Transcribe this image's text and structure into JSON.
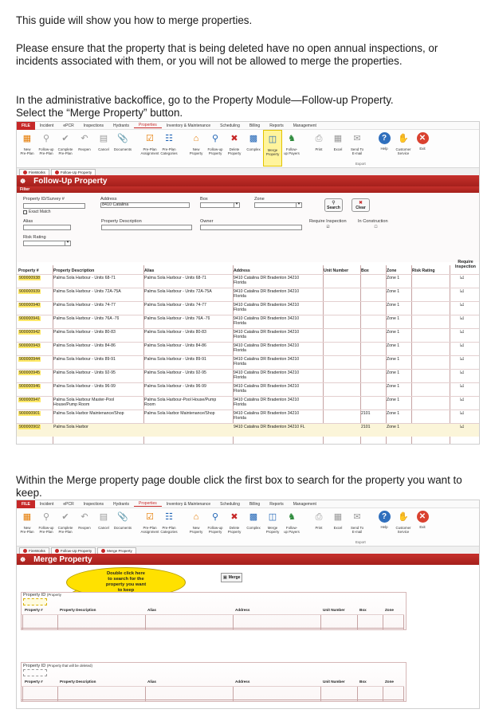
{
  "intro": "This guide will show you how to merge properties.",
  "warning": "Please ensure that the property that is being deleted have no open annual inspections, or incidents associated with them, or you will not be allowed to merge the properties.",
  "step1_line1": "In the administrative backoffice, go to the Property Module—Follow-up Property.",
  "step1_line2": "Select the “Merge Property” button.",
  "step2": "Within the Merge property page double click the first box to search for the property you want to keep.",
  "menu": [
    "FILE",
    "Incident",
    "ePCR",
    "Inspections",
    "Hydrants",
    "Properties",
    "Inventory & Maintenance",
    "Scheduling",
    "Billing",
    "Reports",
    "Management"
  ],
  "ribbon": [
    {
      "l1": "New",
      "l2": "Pre-Plan",
      "icon": "new-preplan-icon"
    },
    {
      "l1": "Follow-up",
      "l2": "Pre-Plan",
      "icon": "follow-up-preplan-icon"
    },
    {
      "l1": "Complete",
      "l2": "Pre-Plan",
      "icon": "complete-icon"
    },
    {
      "l1": "Reopen",
      "l2": "",
      "icon": "reopen-icon"
    },
    {
      "l1": "Cancel",
      "l2": "",
      "icon": "cancel-icon"
    },
    {
      "l1": "Documents",
      "l2": "",
      "icon": "documents-icon"
    },
    {
      "l1": "Pre-Plan",
      "l2": "Assignment",
      "icon": "assignment-icon"
    },
    {
      "l1": "Pre-Plan",
      "l2": "Categories",
      "icon": "categories-icon"
    },
    {
      "l1": "New",
      "l2": "Property",
      "icon": "new-property-icon"
    },
    {
      "l1": "Follow-up",
      "l2": "Property",
      "icon": "follow-up-property-icon"
    },
    {
      "l1": "Delete",
      "l2": "Property",
      "icon": "delete-property-icon"
    },
    {
      "l1": "Complex",
      "l2": "",
      "icon": "complex-icon"
    },
    {
      "l1": "Merge",
      "l2": "Property",
      "icon": "merge-property-icon"
    },
    {
      "l1": "Follow-",
      "l2": "up Payers",
      "icon": "payers-icon"
    },
    {
      "l1": "Print",
      "l2": "",
      "icon": "print-icon"
    },
    {
      "l1": "Excel",
      "l2": "",
      "icon": "excel-icon"
    },
    {
      "l1": "Send To",
      "l2": "E-mail",
      "icon": "email-icon"
    },
    {
      "l1": "Help",
      "l2": "",
      "icon": "help-icon"
    },
    {
      "l1": "Customer",
      "l2": "Service",
      "icon": "customer-service-icon"
    },
    {
      "l1": "Exit",
      "l2": "",
      "icon": "exit-icon"
    }
  ],
  "export_group": "Export",
  "shot1": {
    "tabs": [
      "FireWorks",
      "Follow-Up Property"
    ],
    "title": "Follow-Up Property",
    "filter_label": "Filter",
    "f_id": "Property ID/Survey #",
    "f_address": "Address",
    "address_value": "8410 Catalina",
    "f_box": "Box",
    "f_zone": "Zone",
    "exact_match": "Exact Match",
    "f_alias": "Alias",
    "f_desc": "Property Description",
    "f_owner": "Owner",
    "f_req": "Require Inspection",
    "f_constr": "In Construction",
    "f_risk": "Risk Rating",
    "search": "Search",
    "clear": "Clear",
    "headers": [
      "Property #",
      "Property Description",
      "Alias",
      "Address",
      "Unit Number",
      "Box",
      "Zone",
      "Risk Rating",
      "Require Inspection"
    ],
    "rows": [
      {
        "id": "900000938",
        "desc": "Palma Sola Harbour - Units 68-71",
        "alias": "Palma Sola Harbour - Units 68-71",
        "addr1": "9410 Catalina DR Bradenton 34210",
        "addr2": "Florida",
        "unit": "",
        "box": "",
        "zone": "Zone 1",
        "req": "☑"
      },
      {
        "id": "900000939",
        "desc": "Palma Sola Harbour - Units 72A-75A",
        "alias": "Palma Sola Harbour - Units 72A-75A",
        "addr1": "9410 Catalina DR Bradenton 34210",
        "addr2": "Florida",
        "unit": "",
        "box": "",
        "zone": "Zone 1",
        "req": "☑"
      },
      {
        "id": "900000940",
        "desc": "Palma Sola Harbour - Units 74-77",
        "alias": "Palma Sola Harbour - Units 74-77",
        "addr1": "9410 Catalina DR Bradenton 34210",
        "addr2": "Florida",
        "unit": "",
        "box": "",
        "zone": "Zone 1",
        "req": "☑"
      },
      {
        "id": "900000941",
        "desc": "Palma Sola Harbour - Units 76A -79",
        "alias": "Palma Sola Harbour - Units 76A -79",
        "addr1": "9410 Catalina DR Bradenton 34210",
        "addr2": "Florida",
        "unit": "",
        "box": "",
        "zone": "Zone 1",
        "req": "☑"
      },
      {
        "id": "900000942",
        "desc": "Palma Sola Harbour - Units 80-83",
        "alias": "Palma Sola Harbour - Units 80-83",
        "addr1": "9410 Catalina DR Bradenton 34210",
        "addr2": "Florida",
        "unit": "",
        "box": "",
        "zone": "Zone 1",
        "req": "☑"
      },
      {
        "id": "900000943",
        "desc": "Palma Sola Harbour - Units 84-86",
        "alias": "Palma Sola Harbour - Units 84-86",
        "addr1": "9410 Catalina DR Bradenton 34210",
        "addr2": "Florida",
        "unit": "",
        "box": "",
        "zone": "Zone 1",
        "req": "☑"
      },
      {
        "id": "900000944",
        "desc": "Palma Sola Harbour - Units 89-91",
        "alias": "Palma Sola Harbour - Units 89-91",
        "addr1": "9410 Catalina DR Bradenton 34210",
        "addr2": "Florida",
        "unit": "",
        "box": "",
        "zone": "Zone 1",
        "req": "☑"
      },
      {
        "id": "900000945",
        "desc": "Palma Sola Harbour - Units 92-95",
        "alias": "Palma Sola Harbour - Units 92-95",
        "addr1": "9410 Catalina DR Bradenton 34210",
        "addr2": "Florida",
        "unit": "",
        "box": "",
        "zone": "Zone 1",
        "req": "☑"
      },
      {
        "id": "900000946",
        "desc": "Palma Sola Harbour - Units 96-99",
        "alias": "Palma Sola Harbour - Units 96-99",
        "addr1": "9410 Catalina DR Bradenton 34210",
        "addr2": "Florida",
        "unit": "",
        "box": "",
        "zone": "Zone 1",
        "req": "☑"
      },
      {
        "id": "900000947",
        "desc": "Palma Sola Harbour Master-Pool",
        "desc2": "House/Pump Room",
        "alias": "Palma Sola Harbour-Pool House/Pump",
        "alias2": "Room",
        "addr1": "9410 Catalina DR Bradenton 34210",
        "addr2": "Florida",
        "unit": "",
        "box": "",
        "zone": "Zone 1",
        "req": "☑"
      },
      {
        "id": "900000901",
        "desc": "Palma Sola Harbor Maintenance/Shop",
        "alias": "Palma Sola Harbor Maintenance/Shop",
        "addr1": "9410 Catalina DR Bradenton 34210",
        "addr2": "Florida",
        "unit": "",
        "box": "2101",
        "zone": "Zone 1",
        "req": "☑"
      },
      {
        "id": "900000902",
        "desc": "Palma Sola Harbor",
        "alias": "",
        "addr1": "9410 Catalina DR Bradenton 34210 FL",
        "addr2": "",
        "unit": "",
        "box": "2101",
        "zone": "Zone 1",
        "req": "☑"
      }
    ]
  },
  "shot2": {
    "tabs": [
      "FireWorks",
      "Follow-Up Property",
      "Merge Property"
    ],
    "title": "Merge Property",
    "callout": [
      "Double click here",
      "to search for the",
      "property you want",
      "to keep"
    ],
    "merge_button": "Merge",
    "keep_label": "Property ID",
    "keep_hint": "(Property",
    "delete_label": "Property ID",
    "delete_hint": "(Property that will be deleted)",
    "headers": [
      "Property #",
      "Property Description",
      "Alias",
      "Address",
      "Unit Number",
      "Box",
      "Zone"
    ]
  },
  "colors": {
    "brand_red": "#b3261e",
    "highlight_yellow": "#ffe100"
  }
}
